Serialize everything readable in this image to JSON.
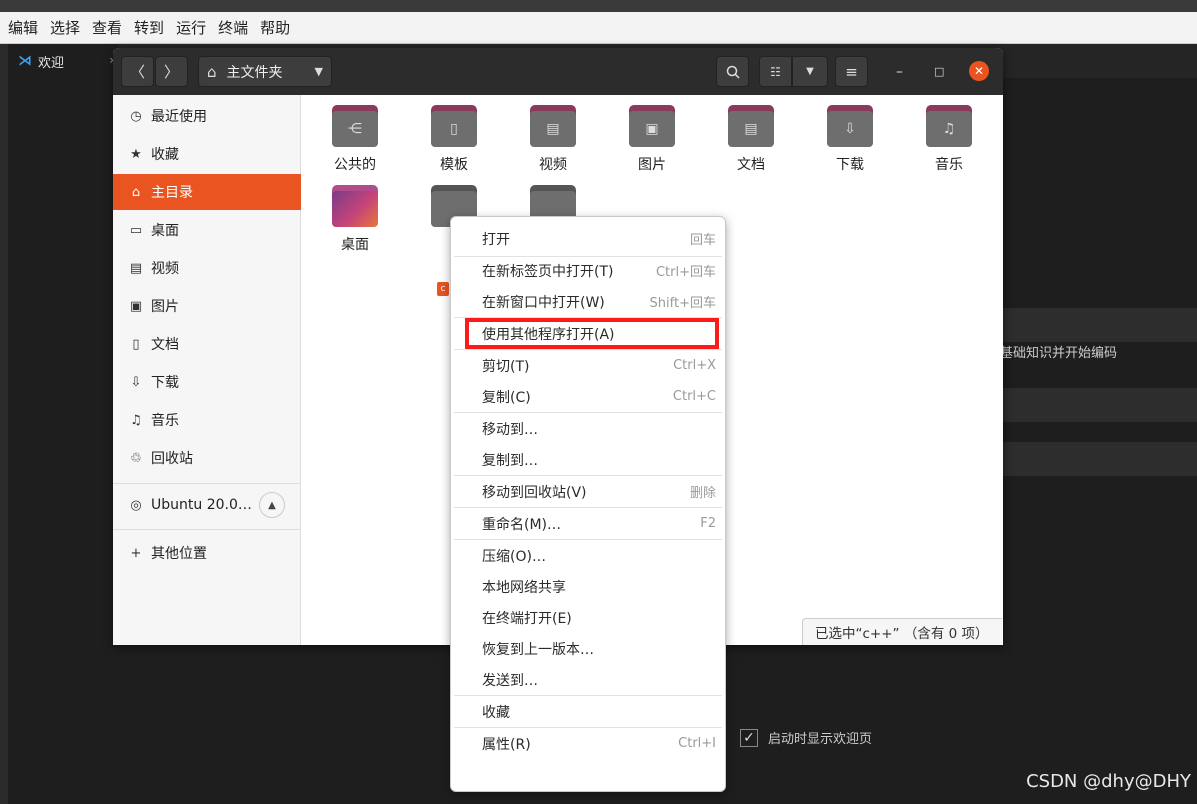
{
  "vscode": {
    "title_partial": "欢迎",
    "menu": [
      "编辑",
      "选择",
      "查看",
      "转到",
      "运行",
      "终端",
      "帮助"
    ],
    "tab_label": "欢迎",
    "panel_text": "基础知识并开始编码",
    "show_welcome_checkbox": "启动时显示欢迎页"
  },
  "files": {
    "path_label": "主文件夹",
    "sidebar": [
      {
        "label": "最近使用",
        "icon": "clock-icon"
      },
      {
        "label": "收藏",
        "icon": "star-icon"
      },
      {
        "label": "主目录",
        "icon": "home-icon",
        "active": true
      },
      {
        "label": "桌面",
        "icon": "desktop-icon"
      },
      {
        "label": "视频",
        "icon": "video-icon"
      },
      {
        "label": "图片",
        "icon": "picture-icon"
      },
      {
        "label": "文档",
        "icon": "document-icon"
      },
      {
        "label": "下载",
        "icon": "download-icon"
      },
      {
        "label": "音乐",
        "icon": "music-icon"
      },
      {
        "label": "回收站",
        "icon": "trash-icon"
      }
    ],
    "device": "Ubuntu 20.0…",
    "other_locations": "其他位置",
    "folders_row1": [
      "公共的",
      "模板",
      "视频",
      "图片",
      "文档",
      "下载",
      "音乐"
    ],
    "folders_row2": [
      "桌面"
    ],
    "status": "已选中“c++” （含有 0 项）"
  },
  "context_menu": {
    "items": [
      {
        "label": "打开",
        "shortcut": "回车"
      },
      {
        "label": "在新标签页中打开(T)",
        "shortcut": "Ctrl+回车"
      },
      {
        "label": "在新窗口中打开(W)",
        "shortcut": "Shift+回车"
      },
      {
        "label": "使用其他程序打开(A)",
        "shortcut": ""
      },
      {
        "label": "剪切(T)",
        "shortcut": "Ctrl+X"
      },
      {
        "label": "复制(C)",
        "shortcut": "Ctrl+C"
      },
      {
        "label": "移动到…",
        "shortcut": ""
      },
      {
        "label": "复制到…",
        "shortcut": ""
      },
      {
        "label": "移动到回收站(V)",
        "shortcut": "删除"
      },
      {
        "label": "重命名(M)…",
        "shortcut": "F2"
      },
      {
        "label": "压缩(O)…",
        "shortcut": ""
      },
      {
        "label": "本地网络共享",
        "shortcut": ""
      },
      {
        "label": "在终端打开(E)",
        "shortcut": ""
      },
      {
        "label": "恢复到上一版本…",
        "shortcut": ""
      },
      {
        "label": "发送到…",
        "shortcut": ""
      },
      {
        "label": "收藏",
        "shortcut": ""
      },
      {
        "label": "属性(R)",
        "shortcut": "Ctrl+I"
      }
    ]
  },
  "watermark": "CSDN @dhy@DHY",
  "colors": {
    "accent": "#e95420",
    "highlight_box": "#ff1a1a",
    "header": "#2c2c2c"
  }
}
